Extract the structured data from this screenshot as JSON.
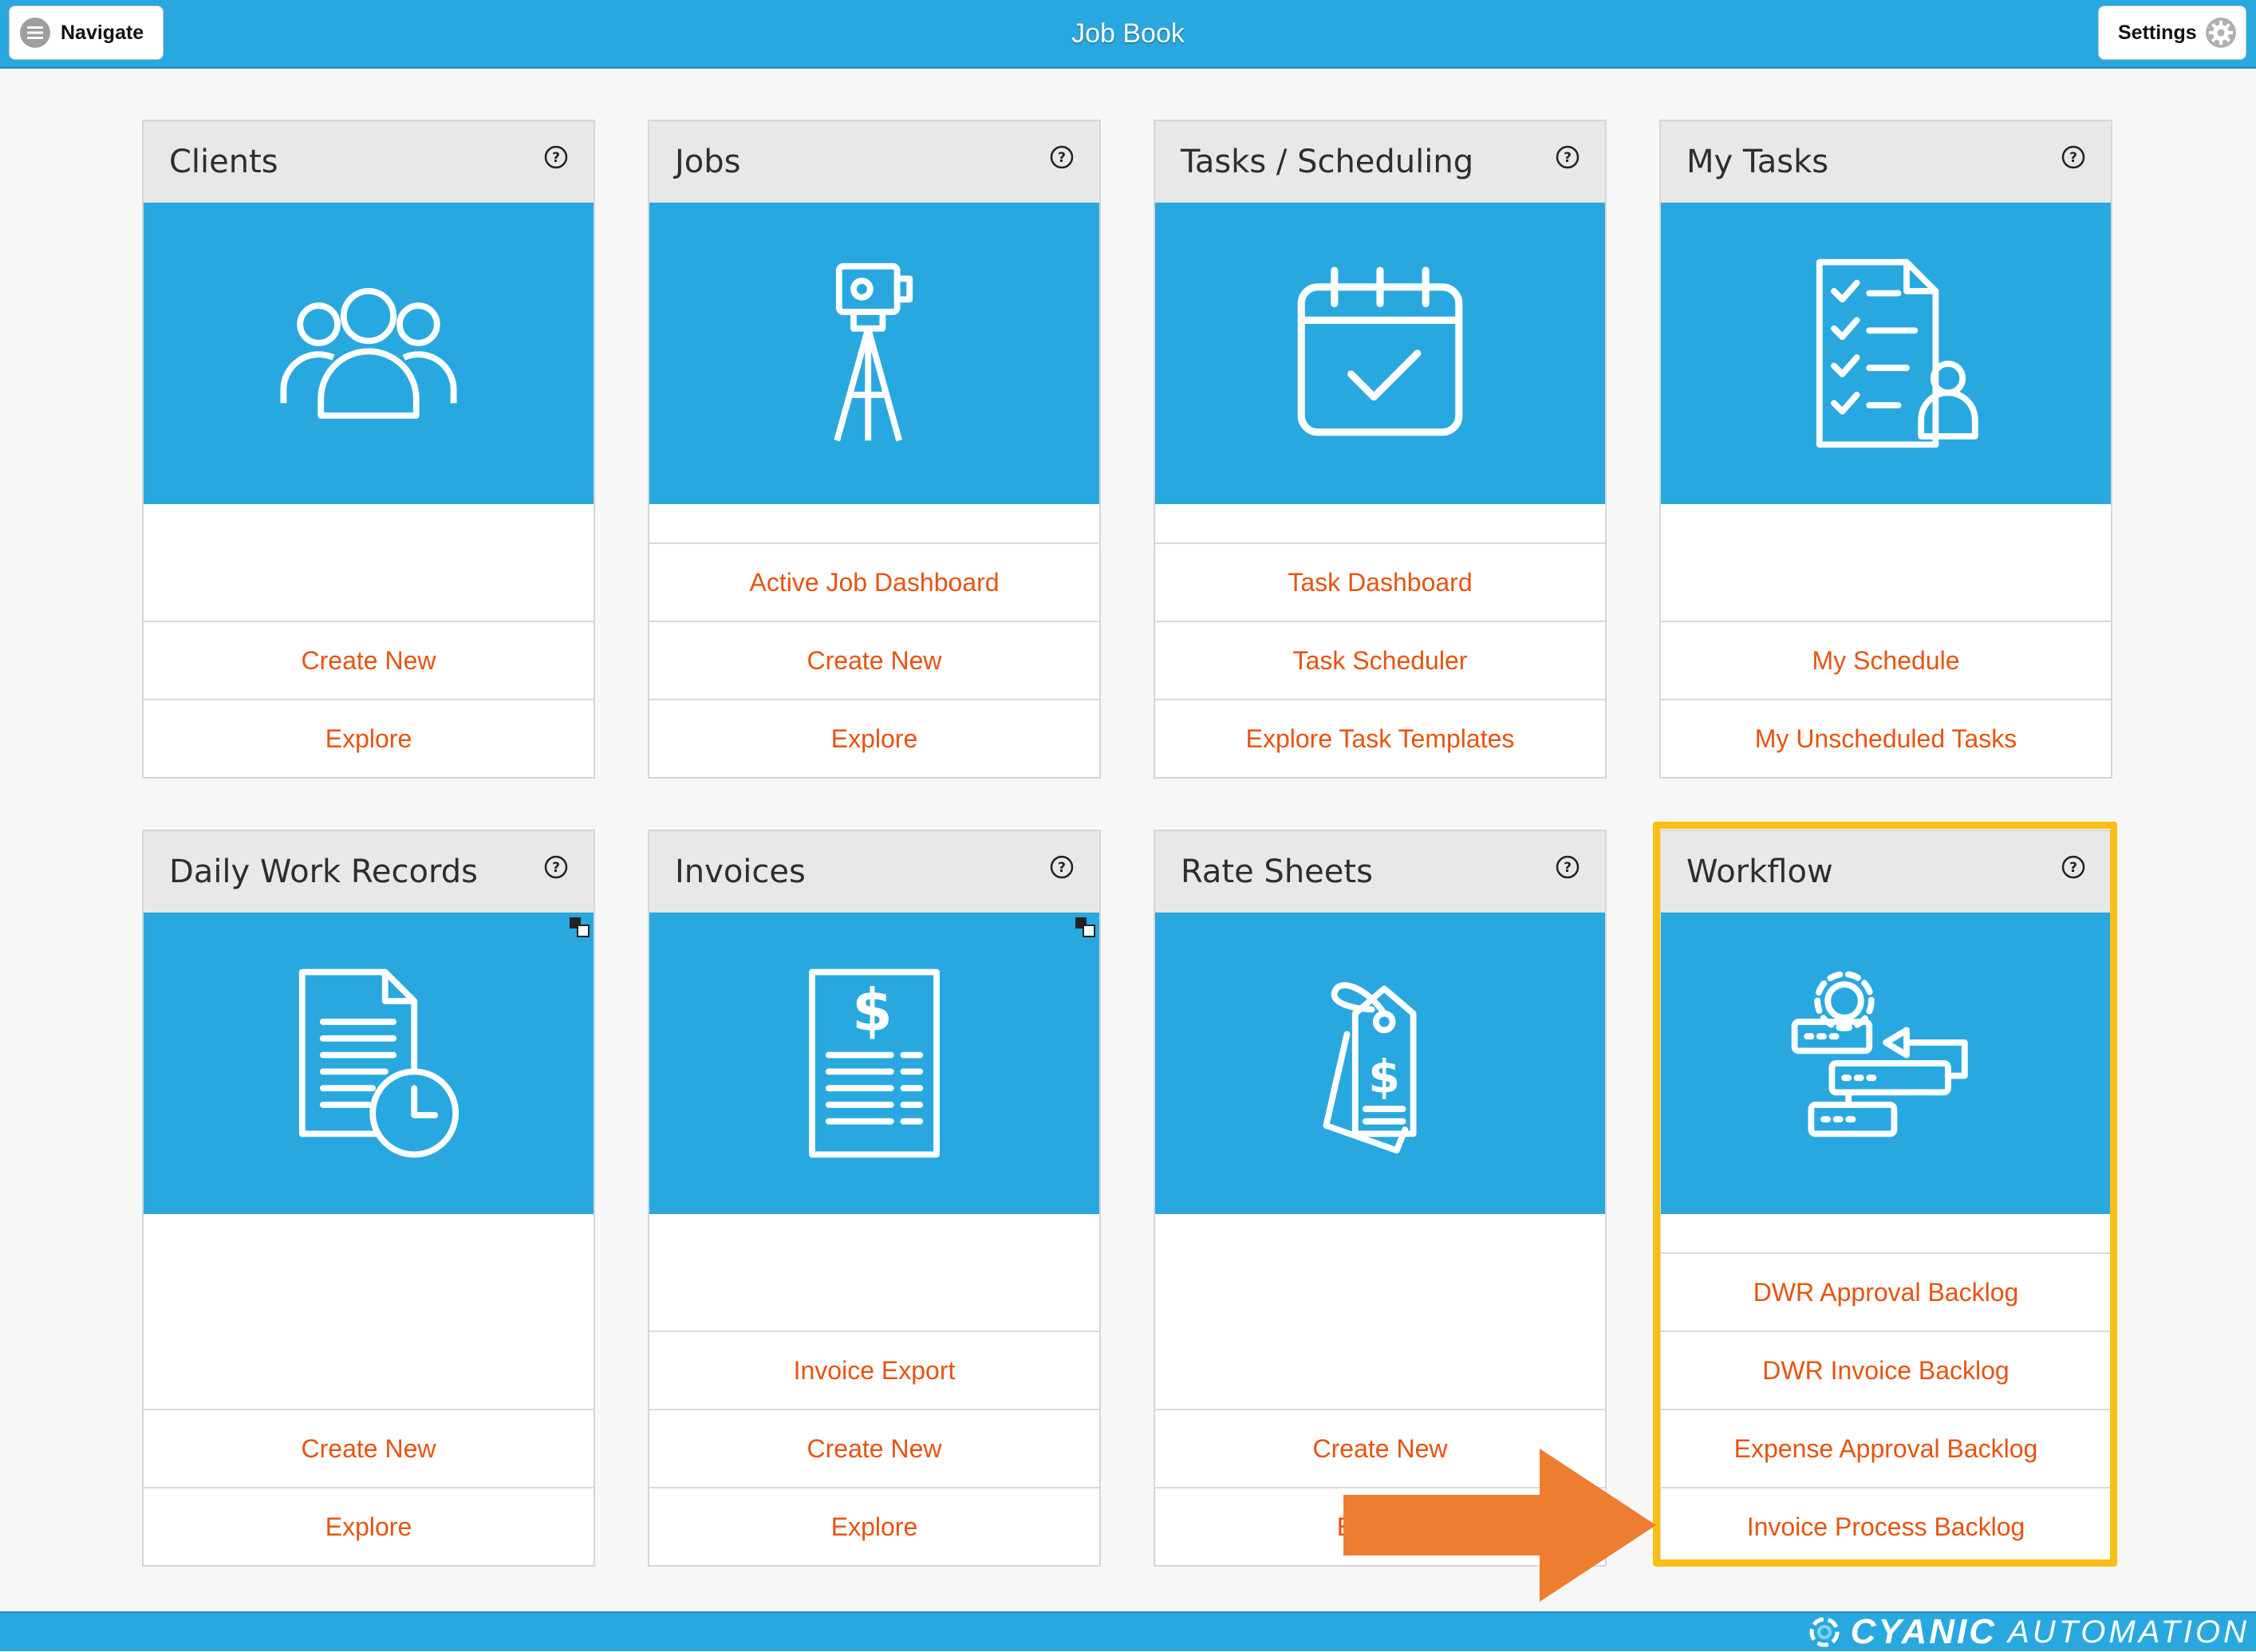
{
  "header": {
    "title": "Job Book",
    "navigate_label": "Navigate",
    "settings_label": "Settings"
  },
  "cards": [
    {
      "title": "Clients",
      "icon": "users-icon",
      "links": [
        "Create New",
        "Explore"
      ]
    },
    {
      "title": "Jobs",
      "icon": "survey-tripod-icon",
      "links": [
        "Active Job Dashboard",
        "Create New",
        "Explore"
      ]
    },
    {
      "title": "Tasks / Scheduling",
      "icon": "calendar-check-icon",
      "links": [
        "Task Dashboard",
        "Task Scheduler",
        "Explore Task Templates"
      ]
    },
    {
      "title": "My Tasks",
      "icon": "task-checklist-user-icon",
      "links": [
        "My Schedule",
        "My Unscheduled Tasks"
      ]
    },
    {
      "title": "Daily Work Records",
      "icon": "document-clock-icon",
      "links": [
        "Create New",
        "Explore"
      ]
    },
    {
      "title": "Invoices",
      "icon": "invoice-dollar-icon",
      "links": [
        "Invoice Export",
        "Create New",
        "Explore"
      ]
    },
    {
      "title": "Rate Sheets",
      "icon": "price-tag-dollar-icon",
      "links": [
        "Create New",
        "Explore"
      ]
    },
    {
      "title": "Workflow",
      "icon": "workflow-gear-icon",
      "links": [
        "DWR Approval Backlog",
        "DWR Invoice Backlog",
        "Expense Approval Backlog",
        "Invoice Process Backlog"
      ]
    }
  ],
  "footer": {
    "brand_primary": "CYANIC",
    "brand_secondary": "AUTOMATION"
  },
  "colors": {
    "header_blue": "#29a8e0",
    "link_orange": "#e8530e",
    "highlight_yellow": "#f9bf15",
    "arrow_orange": "#ed7d31"
  }
}
